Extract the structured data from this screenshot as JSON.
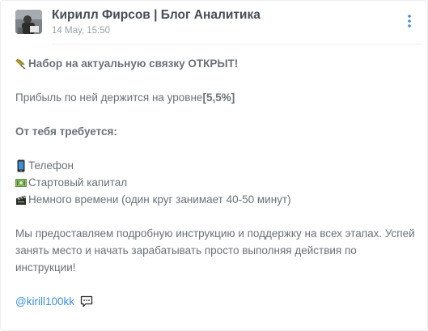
{
  "post": {
    "author": "Кирилл Фирсов | Блог Аналитика",
    "date": "14 May, 15:50"
  },
  "content": {
    "headline": "Набор на актуальную связку ОТКРЫТ!",
    "profit_text": "Прибыль по ней держится на уровне ",
    "profit_value": "[5,5%]",
    "requirements_title": "От тебя требуется:",
    "requirements": [
      "Телефон",
      "Стартовый капитал",
      " Немного времени (один круг занимает 40-50 минут)"
    ],
    "paragraph": "Мы предоставляем подробную инструкцию и поддержку на всех этапах. Успей занять место и начать зарабатывать просто выполняя действия по инструкции!",
    "mention": "@kirill100kk"
  },
  "icons": {
    "headline": "pushpin-icon",
    "phone": "mobile-phone-icon",
    "money": "banknote-icon",
    "time": "clapper-board-icon",
    "menu": "vertical-dots-icon",
    "chat": "speech-bubble-icon"
  },
  "colors": {
    "author": "#454b57",
    "text": "#6b7079",
    "date": "#9aa0a8",
    "link": "#3d8fd6",
    "menu_dots": "#4a90c8"
  }
}
